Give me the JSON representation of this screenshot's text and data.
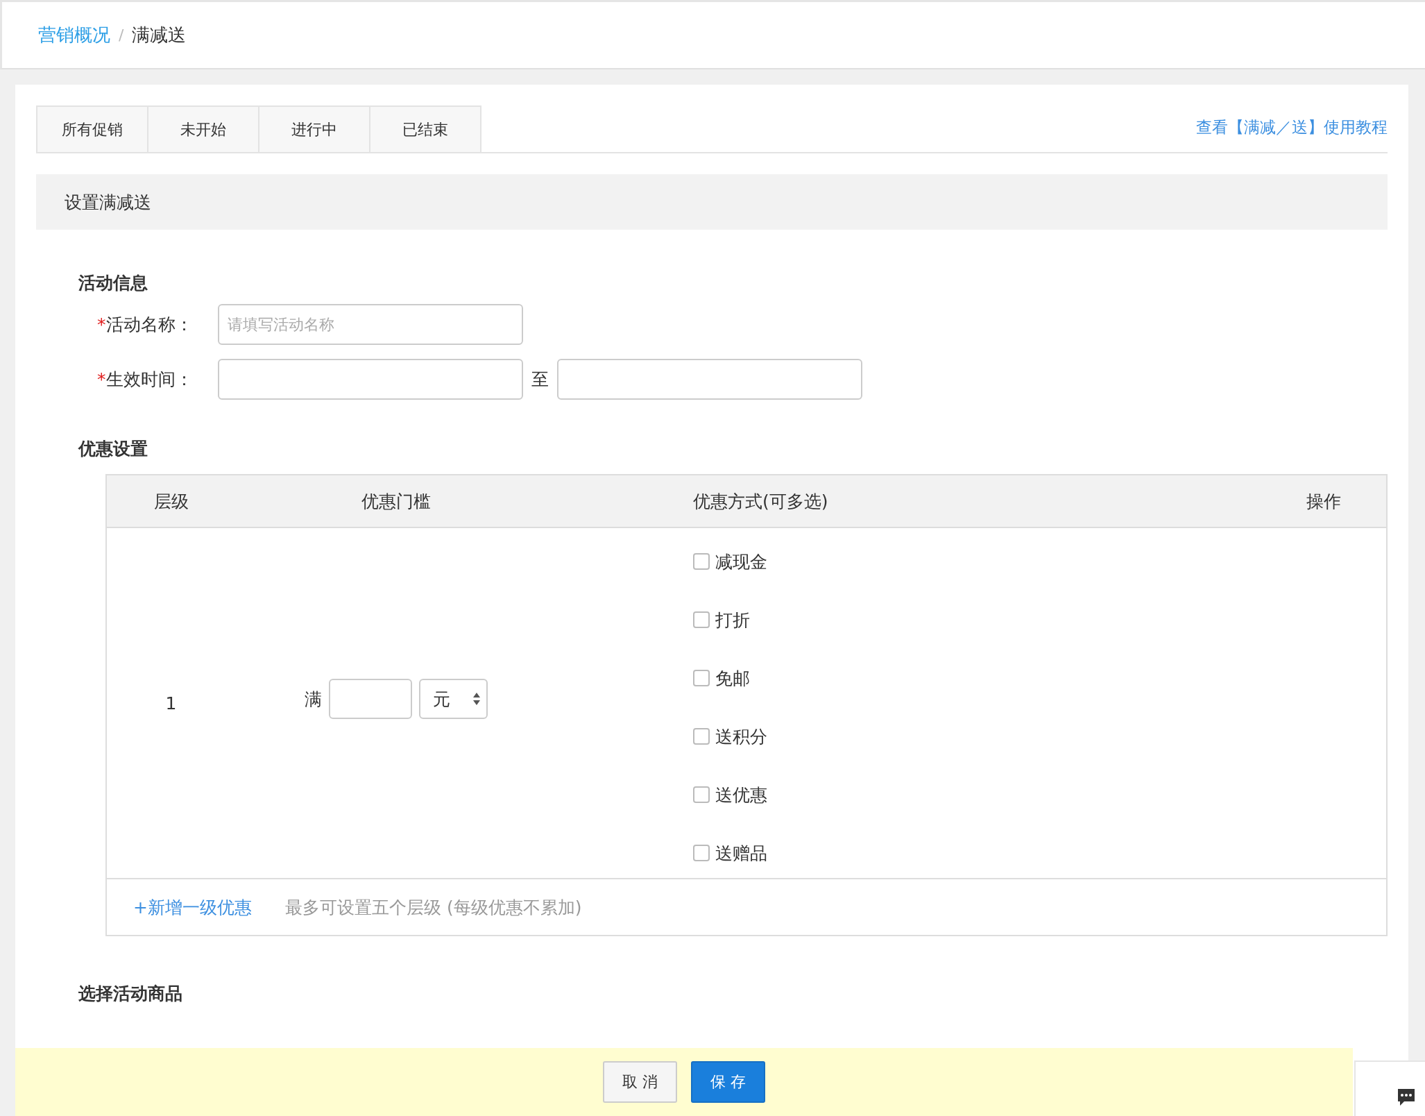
{
  "breadcrumb": [
    {
      "label": "营销概况",
      "kind": "link"
    },
    {
      "label": "/",
      "kind": "separator"
    },
    {
      "label": "满减送",
      "kind": "current"
    }
  ],
  "tabs": [
    {
      "label": "所有促销",
      "selected": false
    },
    {
      "label": "未开始",
      "selected": false
    },
    {
      "label": "进行中",
      "selected": false
    },
    {
      "label": "已结束",
      "selected": false
    }
  ],
  "tutorial_link": "查看【满减／送】使用教程",
  "panel_title": "设置满减送",
  "activity_info": {
    "heading": "活动信息",
    "fields": [
      {
        "label": "活动名称：",
        "required_mark": "*",
        "kind": "text",
        "placeholder": "请填写活动名称"
      },
      {
        "label": "生效时间：",
        "required_mark": "*",
        "kind": "range",
        "separator": "至"
      }
    ]
  },
  "discount": {
    "heading": "优惠设置",
    "columns": [
      "层级",
      "优惠门槛",
      "优惠方式(可多选)",
      "操作"
    ],
    "rows": [
      {
        "level": "1",
        "threshold_prefix": "满",
        "unit": "元",
        "options": [
          {
            "label": "减现金",
            "checked": false
          },
          {
            "label": "打折",
            "checked": false
          },
          {
            "label": "免邮",
            "checked": false
          },
          {
            "label": "送积分",
            "checked": false
          },
          {
            "label": "送优惠",
            "checked": false
          },
          {
            "label": "送赠品",
            "checked": false
          }
        ]
      }
    ],
    "add_link": "+新增一级优惠",
    "note": "最多可设置五个层级 (每级优惠不累加)"
  },
  "products": {
    "heading": "选择活动商品"
  },
  "footer": {
    "buttons": [
      {
        "label": "取 消",
        "kind": "default"
      },
      {
        "label": "保 存",
        "kind": "primary"
      }
    ]
  }
}
